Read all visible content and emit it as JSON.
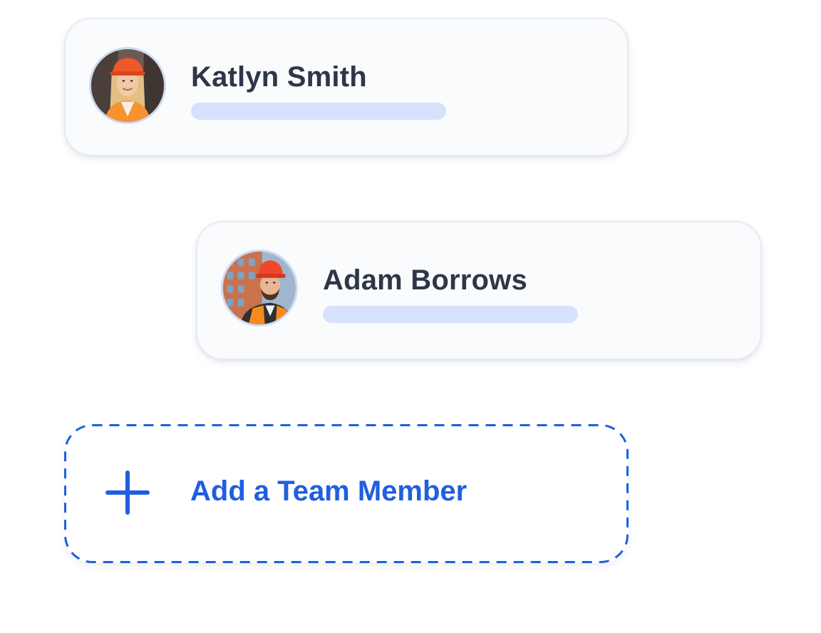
{
  "members": [
    {
      "name": "Katlyn Smith",
      "avatar_icon": "worker-avatar-icon",
      "colors": {
        "helmet": "#f0582a",
        "vest": "#f7922f",
        "hair": "#e6c48a",
        "skin": "#f2c8a8",
        "bg": "#5b4a44"
      }
    },
    {
      "name": "Adam Borrows",
      "avatar_icon": "worker-avatar-icon",
      "colors": {
        "helmet": "#f0472a",
        "vest": "#f58a1f",
        "hair": "#3a2a22",
        "skin": "#e9b592",
        "bg": "#c96e4a"
      }
    }
  ],
  "add_member": {
    "label": "Add a Team Member",
    "icon": "plus-icon"
  },
  "theme": {
    "accent": "#1f5fe0",
    "name_text": "#2d3748",
    "role_bar": "#d6e2fb",
    "card_bg": "#fafbfd",
    "card_border": "#e6eaf3"
  }
}
